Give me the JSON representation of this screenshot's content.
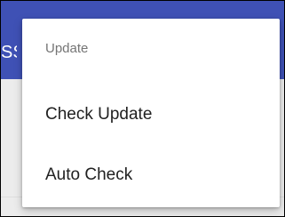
{
  "app_bar": {
    "title_fragment": "SS",
    "color": "#3f51b5"
  },
  "colors": {
    "content_background": "#ececec",
    "menu_background": "#ffffff",
    "header_text": "#757575",
    "item_text": "#212121"
  },
  "menu": {
    "header": "Update",
    "items": [
      {
        "label": "Check Update"
      },
      {
        "label": "Auto Check"
      }
    ]
  }
}
